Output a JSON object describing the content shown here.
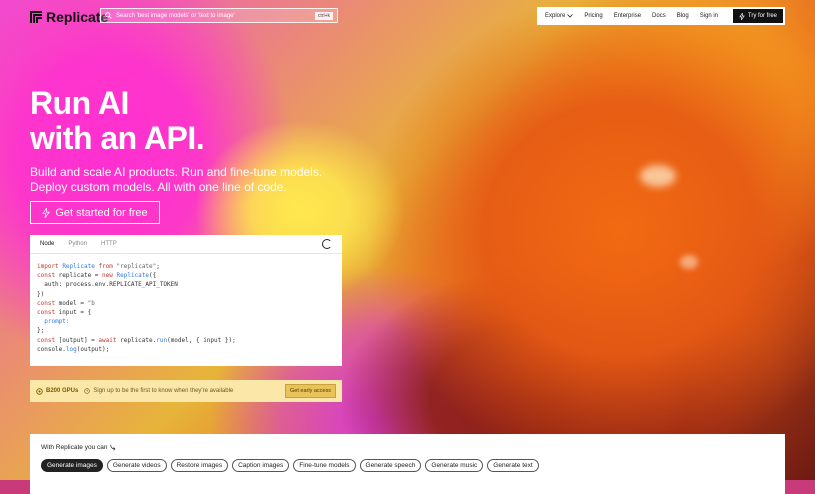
{
  "header": {
    "brand": "Replicate",
    "search": {
      "placeholder": "Search 'best image models' or 'text to image'",
      "shortcut": "ctrl+k"
    },
    "nav": [
      "Explore",
      "Pricing",
      "Enterprise",
      "Docs",
      "Blog",
      "Sign in"
    ],
    "cta": "Try for free"
  },
  "hero": {
    "title_line1": "Run AI",
    "title_line2": "with an API.",
    "subtitle_line1": "Build and scale AI products. Run and fine-tune models.",
    "subtitle_line2": "Deploy custom models. All with one line of code.",
    "cta": "Get started for free"
  },
  "code": {
    "tabs": [
      "Node",
      "Python",
      "HTTP"
    ],
    "active_tab": "Node",
    "lines": [
      "import Replicate from \"replicate\";",
      "const replicate = new Replicate({",
      "  auth: process.env.REPLICATE_API_TOKEN",
      "})",
      "const model = \"b",
      "const input = {",
      "  prompt:",
      "};",
      "const [output] = await replicate.run(model, { input });",
      "console.log(output);"
    ]
  },
  "b200": {
    "tag": "B200 GPUs",
    "message": "Sign up to be the first to know when they're available",
    "button": "Get early access"
  },
  "capabilities": {
    "label": "With Replicate you can",
    "chips": [
      "Generate images",
      "Generate videos",
      "Restore images",
      "Caption images",
      "Fine-tune models",
      "Generate speech",
      "Generate music",
      "Generate text"
    ],
    "active": "Generate images"
  },
  "colors": {
    "brand_dark": "#111111",
    "b200_bg": "#fbe7a8",
    "b200_button": "#e9c35a"
  }
}
